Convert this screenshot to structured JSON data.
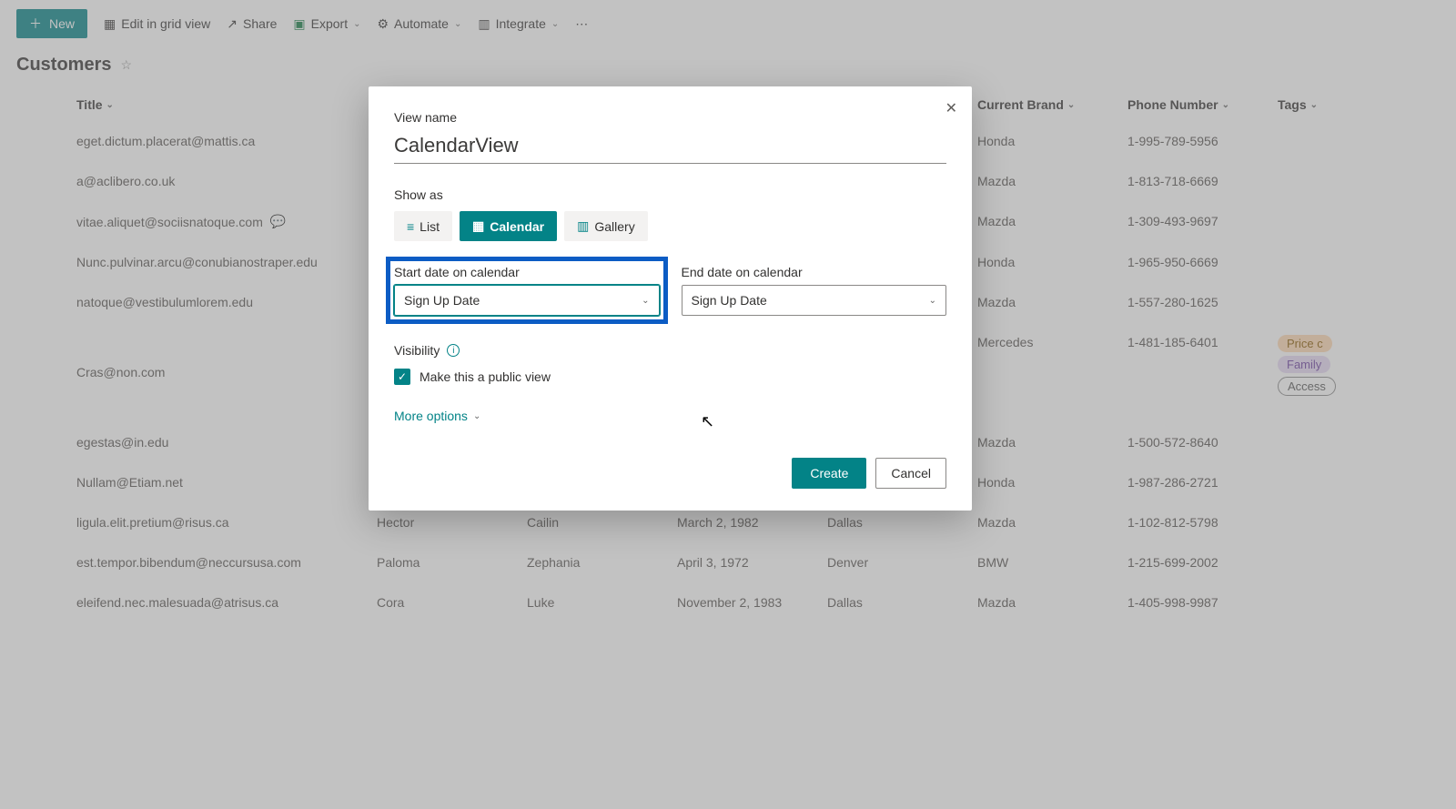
{
  "toolbar": {
    "new_label": "New",
    "edit_grid": "Edit in grid view",
    "share": "Share",
    "export": "Export",
    "automate": "Automate",
    "integrate": "Integrate"
  },
  "page": {
    "title": "Customers"
  },
  "columns": {
    "title": "Title",
    "first": "",
    "last": "",
    "birth": "",
    "city": "",
    "brand": "Current Brand",
    "phone": "Phone Number",
    "tags": "Tags"
  },
  "rows": [
    {
      "title": "eget.dictum.placerat@mattis.ca",
      "first": "",
      "last": "",
      "birth": "",
      "city": "",
      "brand": "Honda",
      "phone": "1-995-789-5956",
      "tags": [],
      "comment": false
    },
    {
      "title": "a@aclibero.co.uk",
      "first": "",
      "last": "",
      "birth": "",
      "city": "",
      "brand": "Mazda",
      "phone": "1-813-718-6669",
      "tags": [],
      "comment": false
    },
    {
      "title": "vitae.aliquet@sociisnatoque.com",
      "first": "",
      "last": "",
      "birth": "",
      "city": "",
      "brand": "Mazda",
      "phone": "1-309-493-9697",
      "tags": [],
      "comment": true
    },
    {
      "title": "Nunc.pulvinar.arcu@conubianostraper.edu",
      "first": "",
      "last": "",
      "birth": "",
      "city": "",
      "brand": "Honda",
      "phone": "1-965-950-6669",
      "tags": [],
      "comment": false
    },
    {
      "title": "natoque@vestibulumlorem.edu",
      "first": "",
      "last": "",
      "birth": "",
      "city": "",
      "brand": "Mazda",
      "phone": "1-557-280-1625",
      "tags": [],
      "comment": false
    },
    {
      "title": "Cras@non.com",
      "first": "",
      "last": "",
      "birth": "",
      "city": "",
      "brand": "Mercedes",
      "phone": "1-481-185-6401",
      "tags": [
        "Price c",
        "Family",
        "Access"
      ],
      "comment": false
    },
    {
      "title": "egestas@in.edu",
      "first": "",
      "last": "",
      "birth": "",
      "city": "",
      "brand": "Mazda",
      "phone": "1-500-572-8640",
      "tags": [],
      "comment": false
    },
    {
      "title": "Nullam@Etiam.net",
      "first": "",
      "last": "",
      "birth": "",
      "city": "",
      "brand": "Honda",
      "phone": "1-987-286-2721",
      "tags": [],
      "comment": false
    },
    {
      "title": "ligula.elit.pretium@risus.ca",
      "first": "Hector",
      "last": "Cailin",
      "birth": "March 2, 1982",
      "city": "Dallas",
      "brand": "Mazda",
      "phone": "1-102-812-5798",
      "tags": [],
      "comment": false
    },
    {
      "title": "est.tempor.bibendum@neccursusa.com",
      "first": "Paloma",
      "last": "Zephania",
      "birth": "April 3, 1972",
      "city": "Denver",
      "brand": "BMW",
      "phone": "1-215-699-2002",
      "tags": [],
      "comment": false
    },
    {
      "title": "eleifend.nec.malesuada@atrisus.ca",
      "first": "Cora",
      "last": "Luke",
      "birth": "November 2, 1983",
      "city": "Dallas",
      "brand": "Mazda",
      "phone": "1-405-998-9987",
      "tags": [],
      "comment": false
    }
  ],
  "dialog": {
    "view_name_label": "View name",
    "view_name_value": "CalendarView",
    "show_as_label": "Show as",
    "view_list": "List",
    "view_calendar": "Calendar",
    "view_gallery": "Gallery",
    "start_date_label": "Start date on calendar",
    "start_date_value": "Sign Up Date",
    "end_date_label": "End date on calendar",
    "end_date_value": "Sign Up Date",
    "visibility_label": "Visibility",
    "public_label": "Make this a public view",
    "more_options": "More options",
    "create": "Create",
    "cancel": "Cancel"
  }
}
